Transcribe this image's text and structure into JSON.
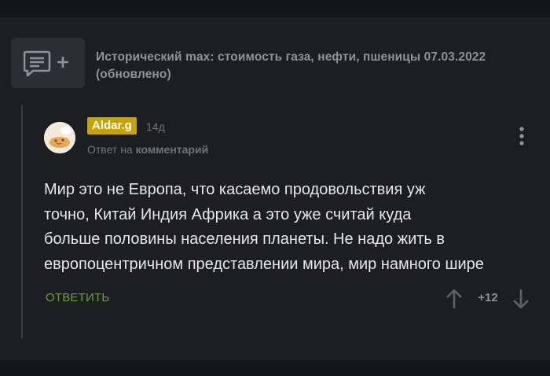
{
  "story": {
    "title": "Исторический max: стоимость газа, нефти, пшеницы 07.03.2022 (обновлено)",
    "add_comment_icon": "comment-plus-icon"
  },
  "comment": {
    "username": "Aldar.g",
    "time_ago": "14д",
    "reply_prefix": "Ответ на",
    "reply_link": "комментарий",
    "text_lines": [
      "Мир это не Европа, что касаемо продовольствия уж",
      "точно, Китай Индия Африка а это уже считай куда",
      "больше половины населения планеты. Не надо жить в",
      "европоцентричном представлении мира, мир намного шире"
    ],
    "reply_label": "ОТВЕТИТЬ",
    "rating": "+12",
    "more_icon": "more-vertical-icon",
    "upvote_icon": "arrow-up-icon",
    "downvote_icon": "arrow-down-icon"
  },
  "colors": {
    "background": "#1c1e21",
    "username_badge": "#c7a300",
    "reply_accent": "#6aa334",
    "muted_text": "#6f7378",
    "body_text": "#e6e7e8"
  }
}
